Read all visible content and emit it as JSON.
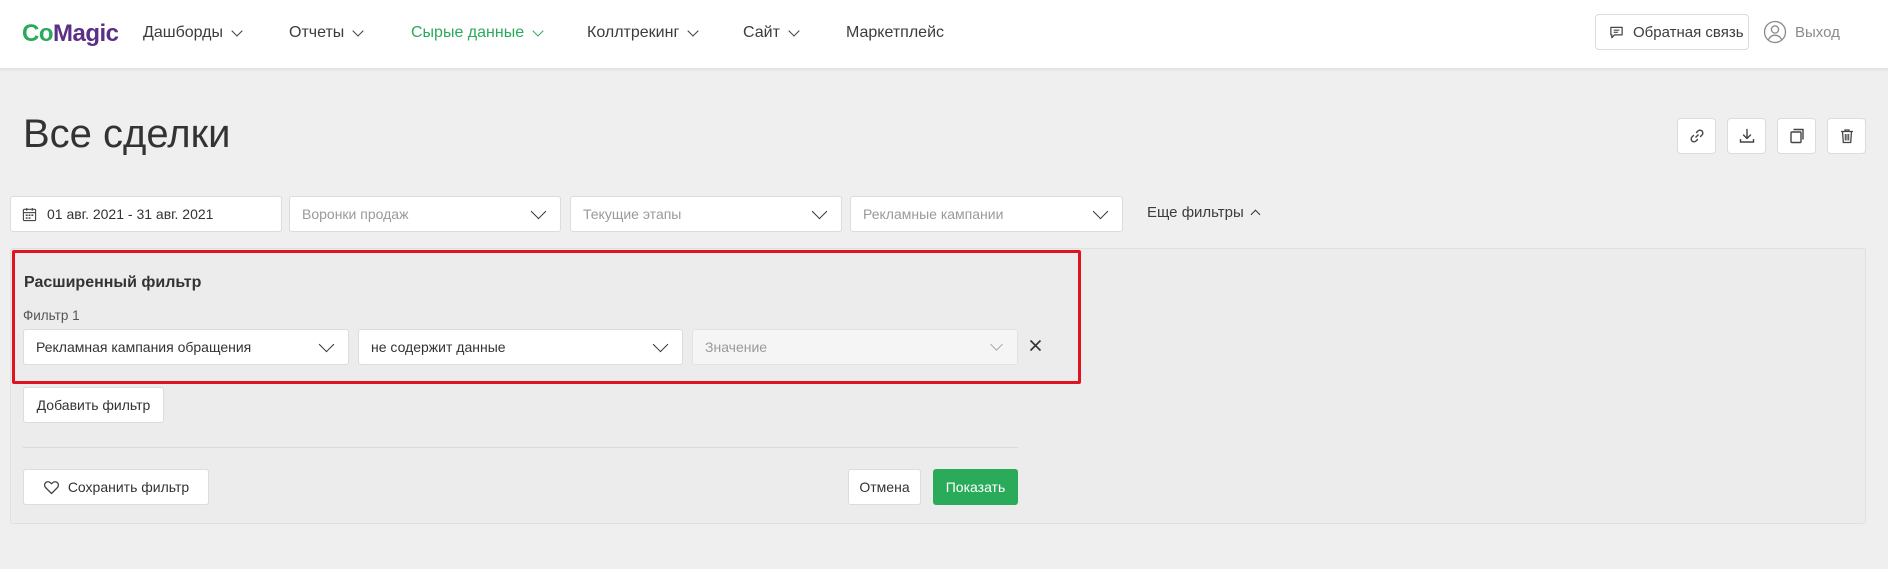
{
  "header": {
    "logo_part1": "Co",
    "logo_part2": "Magic",
    "nav": [
      {
        "label": "Дашборды",
        "dropdown": true,
        "active": false
      },
      {
        "label": "Отчеты",
        "dropdown": true,
        "active": false
      },
      {
        "label": "Сырые данные",
        "dropdown": true,
        "active": true
      },
      {
        "label": "Коллтрекинг",
        "dropdown": true,
        "active": false
      },
      {
        "label": "Сайт",
        "dropdown": true,
        "active": false
      },
      {
        "label": "Маркетплейс",
        "dropdown": false,
        "active": false
      }
    ],
    "feedback_label": "Обратная связь",
    "logout_label": "Выход"
  },
  "page": {
    "title": "Все сделки",
    "actions": [
      "link-icon",
      "download-icon",
      "copy-icon",
      "trash-icon"
    ]
  },
  "filters": {
    "date_range": "01 авг. 2021 - 31 авг. 2021",
    "funnels_placeholder": "Воронки продаж",
    "stages_placeholder": "Текущие этапы",
    "campaigns_placeholder": "Рекламные кампании",
    "more_filters_label": "Еще фильтры"
  },
  "advanced_filter": {
    "title": "Расширенный фильтр",
    "filter_label": "Фильтр 1",
    "field_value": "Рекламная кампания обращения",
    "operator_value": "не содержит данные",
    "value_placeholder": "Значение",
    "add_filter_label": "Добавить фильтр",
    "save_filter_label": "Сохранить фильтр",
    "cancel_label": "Отмена",
    "show_label": "Показать"
  },
  "colors": {
    "accent": "#2aab5a",
    "brand_purple": "#5b2f86",
    "highlight": "#e0141e"
  }
}
